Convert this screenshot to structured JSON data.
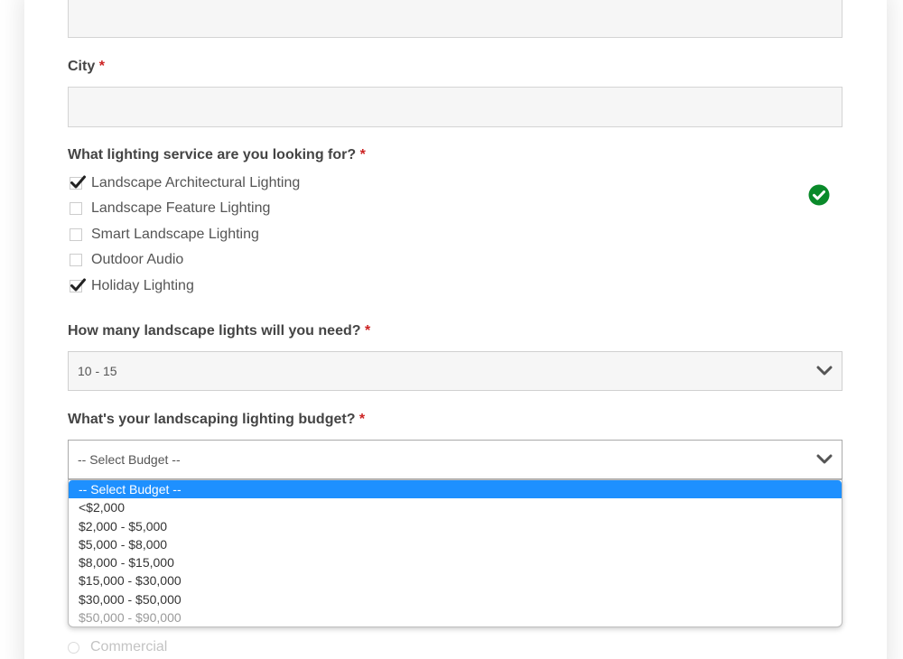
{
  "form": {
    "city": {
      "label": "City",
      "required_mark": "*"
    },
    "lighting_service": {
      "label": "What lighting service are you looking for?",
      "required_mark": "*",
      "options": [
        {
          "label": "Landscape Architectural Lighting",
          "checked": true
        },
        {
          "label": "Landscape Feature Lighting",
          "checked": false
        },
        {
          "label": "Smart Landscape Lighting",
          "checked": false
        },
        {
          "label": "Outdoor Audio",
          "checked": false
        },
        {
          "label": "Holiday Lighting",
          "checked": true
        }
      ],
      "valid_icon": "check-circle-icon",
      "valid_color": "#0a8a2a"
    },
    "lights_count": {
      "label": "How many landscape lights will you need?",
      "required_mark": "*",
      "selected_value": "10 - 15"
    },
    "budget": {
      "label": "What's your landscaping lighting budget?",
      "required_mark": "*",
      "selected_value": "-- Select Budget --",
      "options": [
        "-- Select Budget --",
        "<$2,000",
        "$2,000 - $5,000",
        "$5,000 - $8,000",
        "$8,000 - $15,000",
        "$15,000 - $30,000",
        "$30,000 - $50,000",
        "$50,000 - $90,000"
      ],
      "highlight_color": "#1e90ff"
    },
    "property_type": {
      "first_option": "Commercial"
    }
  }
}
